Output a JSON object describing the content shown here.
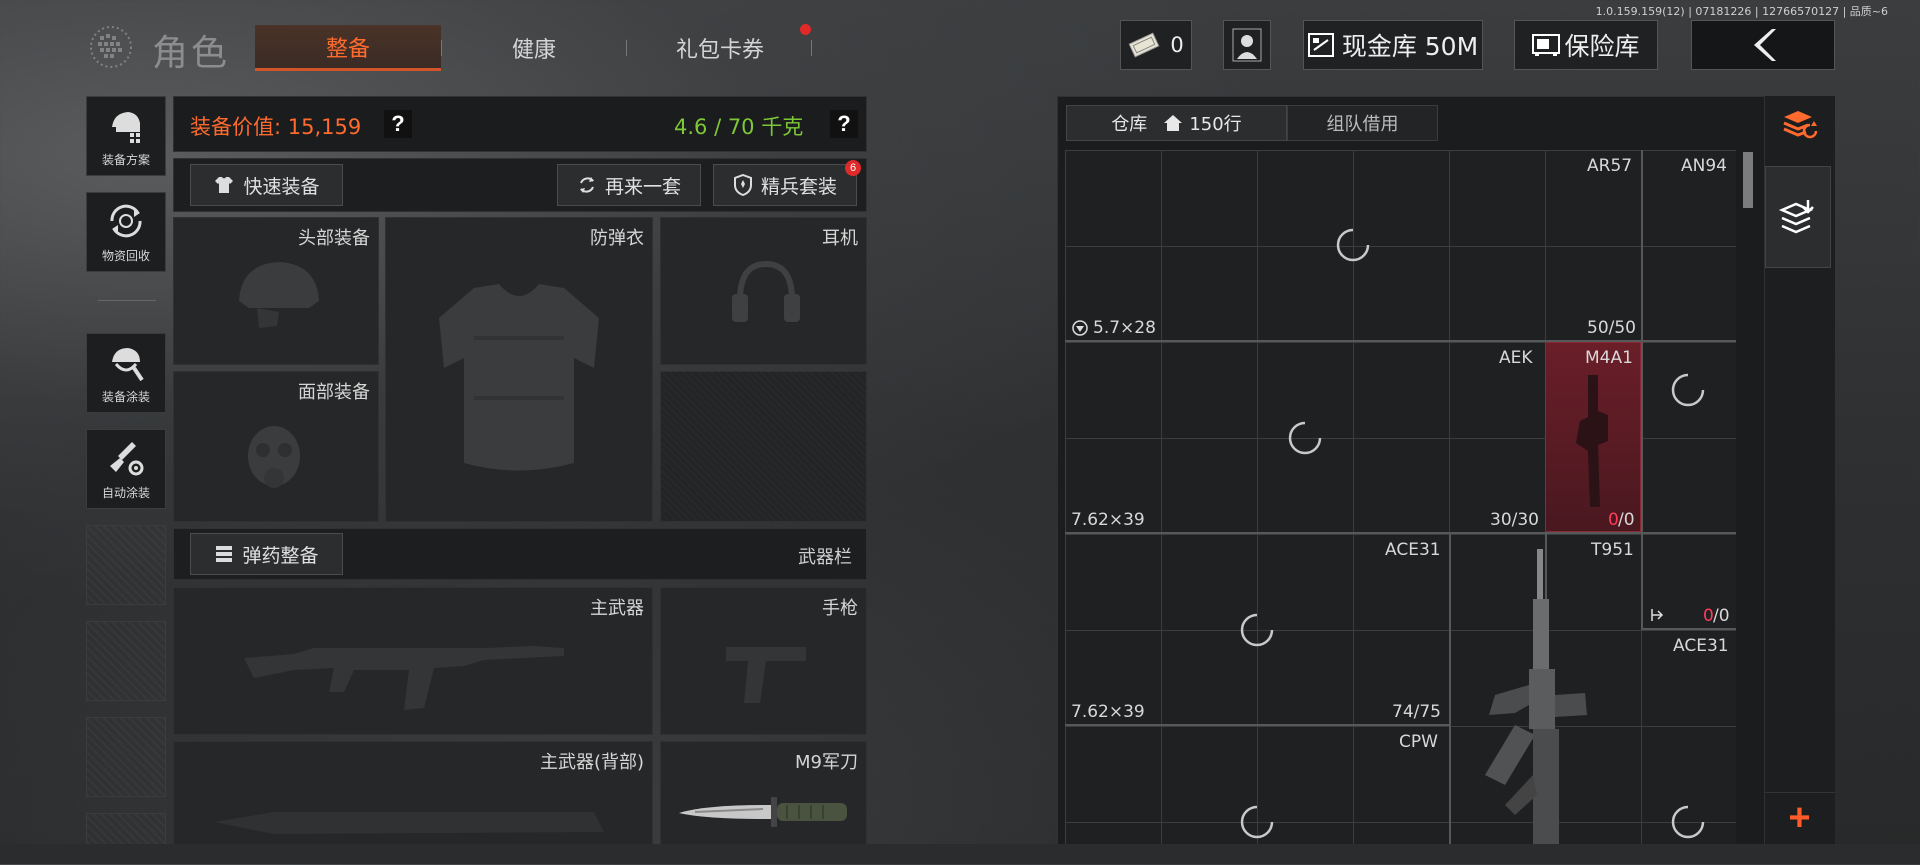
{
  "version": "1.0.159.159(12) | 07181226 | 12766570127 | 品质~6",
  "header": {
    "title": "角色",
    "tabs": [
      "整备",
      "健康",
      "礼包卡券"
    ],
    "ticket_count": "0",
    "cash_label": "现金库 50M",
    "safe_label": "保险库",
    "accent": "#ff6a2e"
  },
  "sidebar": {
    "items": [
      {
        "label": "装备方案",
        "icon": "gear-plan-icon"
      },
      {
        "label": "物资回收",
        "icon": "recycle-icon"
      },
      {
        "label": "装备涂装",
        "icon": "helmet-paint-icon"
      },
      {
        "label": "自动涂装",
        "icon": "auto-paint-icon"
      }
    ]
  },
  "equipment": {
    "value_label": "装备价值: 15,159",
    "weight_label": "4.6 / 70 千克",
    "weight_color": "#7ec837",
    "quick_equip": "快速装备",
    "reroll": "再来一套",
    "elite_kit": "精兵套装",
    "elite_badge": "6",
    "slots": {
      "head": "头部装备",
      "armor": "防弹衣",
      "headset": "耳机",
      "face": "面部装备",
      "primary": "主武器",
      "pistol": "手枪",
      "primary_back": "主武器(背部)",
      "knife": "M9军刀"
    },
    "ammo_button": "弹药整备",
    "weapon_bar": "武器栏"
  },
  "warehouse": {
    "tab_storage": "仓库",
    "tab_storage_rows": "150行",
    "tab_team": "组队借用",
    "items": [
      {
        "name": "AR57",
        "ammo": "5.7×28",
        "count": "50/50"
      },
      {
        "name": "AN94"
      },
      {
        "name": "AEK",
        "ammo": "7.62×39",
        "count": "30/30"
      },
      {
        "name": "M4A1",
        "count_a": "0",
        "count_b": "/0"
      },
      {
        "name": "ACE31",
        "ammo": "7.62×39",
        "count": "74/75"
      },
      {
        "name": "T951",
        "count_a": "0",
        "count_b": "/0"
      },
      {
        "name": "ACE31"
      },
      {
        "name": "CPW"
      }
    ],
    "plus": "+"
  }
}
